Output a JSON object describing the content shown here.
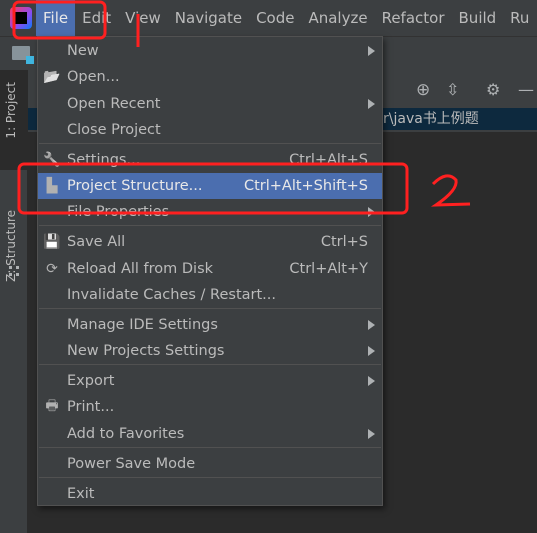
{
  "menubar": {
    "items": [
      "File",
      "Edit",
      "View",
      "Navigate",
      "Code",
      "Analyze",
      "Refactor",
      "Build",
      "Ru"
    ],
    "active": "File"
  },
  "side_tabs": {
    "project": "1: Project",
    "structure": "Z: Structure"
  },
  "tree": {
    "selected_path": "r\\java书上例题"
  },
  "file_menu": {
    "items": [
      {
        "label": "New",
        "submenu": true
      },
      {
        "label": "Open...",
        "icon": "folder-open-icon"
      },
      {
        "label": "Open Recent",
        "submenu": true
      },
      {
        "label": "Close Project"
      },
      {
        "label": "Settings...",
        "icon": "wrench-icon",
        "shortcut": "Ctrl+Alt+S"
      },
      {
        "label": "Project Structure...",
        "icon": "project-structure-icon",
        "shortcut": "Ctrl+Alt+Shift+S",
        "selected": true
      },
      {
        "label": "File Properties",
        "submenu": true
      },
      {
        "label": "Save All",
        "icon": "save-icon",
        "shortcut": "Ctrl+S"
      },
      {
        "label": "Reload All from Disk",
        "icon": "reload-icon",
        "shortcut": "Ctrl+Alt+Y"
      },
      {
        "label": "Invalidate Caches / Restart..."
      },
      {
        "label": "Manage IDE Settings",
        "submenu": true
      },
      {
        "label": "New Projects Settings",
        "submenu": true
      },
      {
        "label": "Export",
        "submenu": true
      },
      {
        "label": "Print...",
        "icon": "print-icon"
      },
      {
        "label": "Add to Favorites",
        "submenu": true
      },
      {
        "label": "Power Save Mode"
      },
      {
        "label": "Exit"
      }
    ]
  },
  "annotations": {
    "step1": "1",
    "step2": "2",
    "color": "#ff2020"
  },
  "colors": {
    "selection": "#4b6eaf",
    "menu_bg": "#3c3f41",
    "tree_selection": "#0d293e"
  }
}
